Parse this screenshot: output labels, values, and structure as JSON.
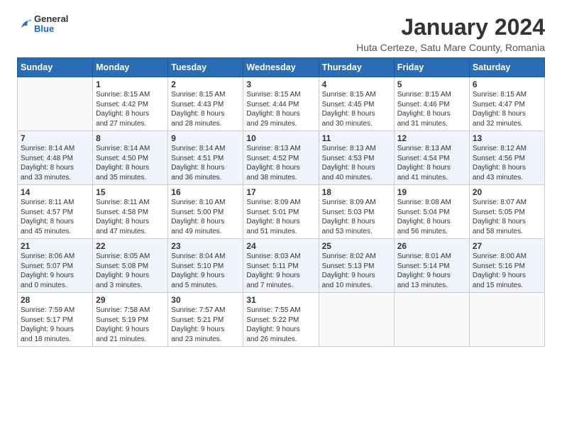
{
  "logo": {
    "general": "General",
    "blue": "Blue"
  },
  "title": "January 2024",
  "subtitle": "Huta Certeze, Satu Mare County, Romania",
  "weekdays": [
    "Sunday",
    "Monday",
    "Tuesday",
    "Wednesday",
    "Thursday",
    "Friday",
    "Saturday"
  ],
  "weeks": [
    [
      {
        "day": "",
        "lines": []
      },
      {
        "day": "1",
        "lines": [
          "Sunrise: 8:15 AM",
          "Sunset: 4:42 PM",
          "Daylight: 8 hours",
          "and 27 minutes."
        ]
      },
      {
        "day": "2",
        "lines": [
          "Sunrise: 8:15 AM",
          "Sunset: 4:43 PM",
          "Daylight: 8 hours",
          "and 28 minutes."
        ]
      },
      {
        "day": "3",
        "lines": [
          "Sunrise: 8:15 AM",
          "Sunset: 4:44 PM",
          "Daylight: 8 hours",
          "and 29 minutes."
        ]
      },
      {
        "day": "4",
        "lines": [
          "Sunrise: 8:15 AM",
          "Sunset: 4:45 PM",
          "Daylight: 8 hours",
          "and 30 minutes."
        ]
      },
      {
        "day": "5",
        "lines": [
          "Sunrise: 8:15 AM",
          "Sunset: 4:46 PM",
          "Daylight: 8 hours",
          "and 31 minutes."
        ]
      },
      {
        "day": "6",
        "lines": [
          "Sunrise: 8:15 AM",
          "Sunset: 4:47 PM",
          "Daylight: 8 hours",
          "and 32 minutes."
        ]
      }
    ],
    [
      {
        "day": "7",
        "lines": [
          "Sunrise: 8:14 AM",
          "Sunset: 4:48 PM",
          "Daylight: 8 hours",
          "and 33 minutes."
        ]
      },
      {
        "day": "8",
        "lines": [
          "Sunrise: 8:14 AM",
          "Sunset: 4:50 PM",
          "Daylight: 8 hours",
          "and 35 minutes."
        ]
      },
      {
        "day": "9",
        "lines": [
          "Sunrise: 8:14 AM",
          "Sunset: 4:51 PM",
          "Daylight: 8 hours",
          "and 36 minutes."
        ]
      },
      {
        "day": "10",
        "lines": [
          "Sunrise: 8:13 AM",
          "Sunset: 4:52 PM",
          "Daylight: 8 hours",
          "and 38 minutes."
        ]
      },
      {
        "day": "11",
        "lines": [
          "Sunrise: 8:13 AM",
          "Sunset: 4:53 PM",
          "Daylight: 8 hours",
          "and 40 minutes."
        ]
      },
      {
        "day": "12",
        "lines": [
          "Sunrise: 8:13 AM",
          "Sunset: 4:54 PM",
          "Daylight: 8 hours",
          "and 41 minutes."
        ]
      },
      {
        "day": "13",
        "lines": [
          "Sunrise: 8:12 AM",
          "Sunset: 4:56 PM",
          "Daylight: 8 hours",
          "and 43 minutes."
        ]
      }
    ],
    [
      {
        "day": "14",
        "lines": [
          "Sunrise: 8:11 AM",
          "Sunset: 4:57 PM",
          "Daylight: 8 hours",
          "and 45 minutes."
        ]
      },
      {
        "day": "15",
        "lines": [
          "Sunrise: 8:11 AM",
          "Sunset: 4:58 PM",
          "Daylight: 8 hours",
          "and 47 minutes."
        ]
      },
      {
        "day": "16",
        "lines": [
          "Sunrise: 8:10 AM",
          "Sunset: 5:00 PM",
          "Daylight: 8 hours",
          "and 49 minutes."
        ]
      },
      {
        "day": "17",
        "lines": [
          "Sunrise: 8:09 AM",
          "Sunset: 5:01 PM",
          "Daylight: 8 hours",
          "and 51 minutes."
        ]
      },
      {
        "day": "18",
        "lines": [
          "Sunrise: 8:09 AM",
          "Sunset: 5:03 PM",
          "Daylight: 8 hours",
          "and 53 minutes."
        ]
      },
      {
        "day": "19",
        "lines": [
          "Sunrise: 8:08 AM",
          "Sunset: 5:04 PM",
          "Daylight: 8 hours",
          "and 56 minutes."
        ]
      },
      {
        "day": "20",
        "lines": [
          "Sunrise: 8:07 AM",
          "Sunset: 5:05 PM",
          "Daylight: 8 hours",
          "and 58 minutes."
        ]
      }
    ],
    [
      {
        "day": "21",
        "lines": [
          "Sunrise: 8:06 AM",
          "Sunset: 5:07 PM",
          "Daylight: 9 hours",
          "and 0 minutes."
        ]
      },
      {
        "day": "22",
        "lines": [
          "Sunrise: 8:05 AM",
          "Sunset: 5:08 PM",
          "Daylight: 9 hours",
          "and 3 minutes."
        ]
      },
      {
        "day": "23",
        "lines": [
          "Sunrise: 8:04 AM",
          "Sunset: 5:10 PM",
          "Daylight: 9 hours",
          "and 5 minutes."
        ]
      },
      {
        "day": "24",
        "lines": [
          "Sunrise: 8:03 AM",
          "Sunset: 5:11 PM",
          "Daylight: 9 hours",
          "and 7 minutes."
        ]
      },
      {
        "day": "25",
        "lines": [
          "Sunrise: 8:02 AM",
          "Sunset: 5:13 PM",
          "Daylight: 9 hours",
          "and 10 minutes."
        ]
      },
      {
        "day": "26",
        "lines": [
          "Sunrise: 8:01 AM",
          "Sunset: 5:14 PM",
          "Daylight: 9 hours",
          "and 13 minutes."
        ]
      },
      {
        "day": "27",
        "lines": [
          "Sunrise: 8:00 AM",
          "Sunset: 5:16 PM",
          "Daylight: 9 hours",
          "and 15 minutes."
        ]
      }
    ],
    [
      {
        "day": "28",
        "lines": [
          "Sunrise: 7:59 AM",
          "Sunset: 5:17 PM",
          "Daylight: 9 hours",
          "and 18 minutes."
        ]
      },
      {
        "day": "29",
        "lines": [
          "Sunrise: 7:58 AM",
          "Sunset: 5:19 PM",
          "Daylight: 9 hours",
          "and 21 minutes."
        ]
      },
      {
        "day": "30",
        "lines": [
          "Sunrise: 7:57 AM",
          "Sunset: 5:21 PM",
          "Daylight: 9 hours",
          "and 23 minutes."
        ]
      },
      {
        "day": "31",
        "lines": [
          "Sunrise: 7:55 AM",
          "Sunset: 5:22 PM",
          "Daylight: 9 hours",
          "and 26 minutes."
        ]
      },
      {
        "day": "",
        "lines": []
      },
      {
        "day": "",
        "lines": []
      },
      {
        "day": "",
        "lines": []
      }
    ]
  ]
}
